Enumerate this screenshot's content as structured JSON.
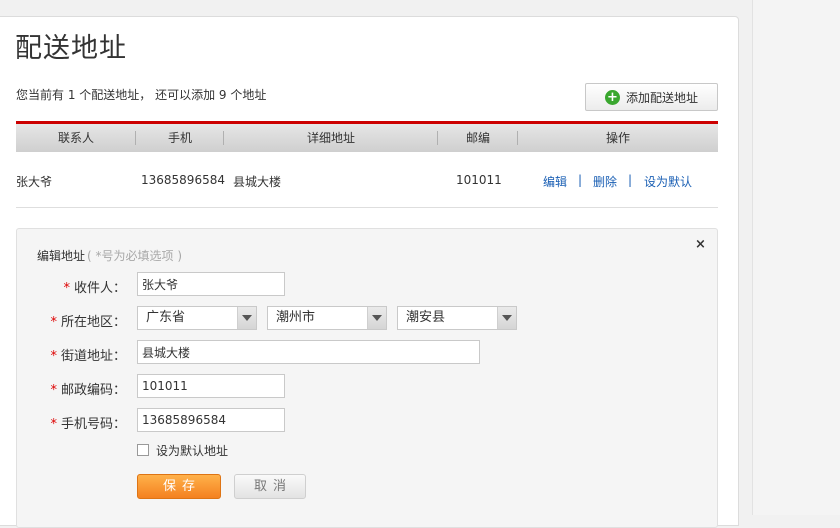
{
  "page": {
    "title": "配送地址",
    "summary": "您当前有 1 个配送地址， 还可以添加 9 个地址",
    "add_button_label": "添加配送地址"
  },
  "table": {
    "headers": [
      "联系人",
      "手机",
      "详细地址",
      "邮编",
      "操作"
    ],
    "rows": [
      {
        "contact": "张大爷",
        "phone": "13685896584",
        "address": "县城大楼",
        "zip": "101011",
        "actions": {
          "edit": "编辑",
          "delete": "删除",
          "set_default": "设为默认",
          "separator": "|"
        }
      }
    ]
  },
  "edit_form": {
    "title": "编辑地址",
    "hint": "( *号为必填选项 )",
    "close_symbol": "×",
    "required_mark": "*",
    "labels": {
      "recipient": "收件人：",
      "region": "所在地区：",
      "street": "街道地址：",
      "postcode": "邮政编码：",
      "mobile": "手机号码："
    },
    "values": {
      "recipient": "张大爷",
      "province": "广东省",
      "city": "潮州市",
      "county": "潮安县",
      "street": "县城大楼",
      "postcode": "101011",
      "mobile": "13685896584"
    },
    "default_checkbox_label": "设为默认地址",
    "default_checked": false,
    "save_label": "保存",
    "cancel_label": "取消"
  },
  "colors": {
    "accent_red": "#cc0000",
    "link_blue": "#1a5fb4",
    "save_orange": "#f48120",
    "add_green": "#3aa72f"
  }
}
